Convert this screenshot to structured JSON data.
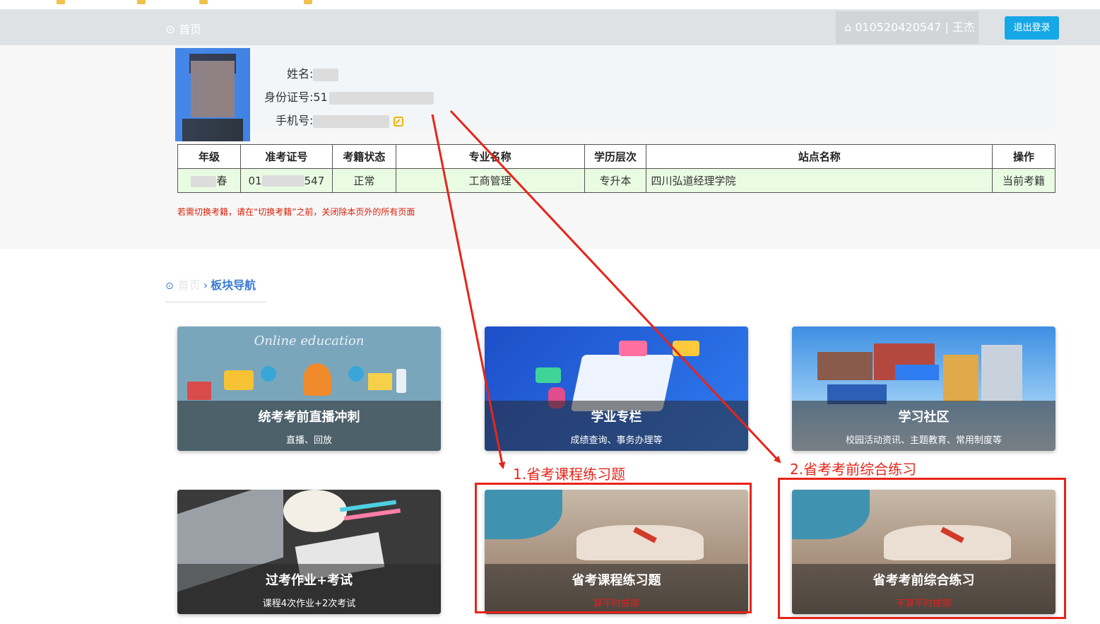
{
  "header": {
    "breadcrumb": "首页",
    "user_info": "010520420547 | 王杰",
    "logout_label": "退出登录"
  },
  "profile": {
    "name_label": "姓名:",
    "id_label": "身份证号:",
    "id_prefix": "51",
    "phone_label": "手机号:"
  },
  "table": {
    "headers": [
      "年级",
      "准考证号",
      "考籍状态",
      "专业名称",
      "学历层次",
      "站点名称",
      "操作"
    ],
    "row": {
      "grade_suffix": "春",
      "exam_no_prefix": "01",
      "exam_no_suffix": "547",
      "status": "正常",
      "major": "工商管理",
      "level": "专升本",
      "site": "四川弘道经理学院",
      "action": "当前考籍"
    }
  },
  "notice": "若需切换考籍，请在“切换考籍”之前，关闭除本页外的所有页面",
  "section": {
    "home": "首页",
    "sep": "›",
    "current": "板块导航"
  },
  "cards": [
    {
      "title": "统考考前直播冲刺",
      "subtitle": "直播、回放",
      "banner_text": "Online education"
    },
    {
      "title": "学业专栏",
      "subtitle": "成绩查询、事务办理等"
    },
    {
      "title": "学习社区",
      "subtitle": "校园活动资讯、主题教育、常用制度等"
    },
    {
      "title": "过考作业+考试",
      "subtitle": "课程4次作业+2次考试"
    },
    {
      "title": "省考课程练习题",
      "subtitle": "算平时成绩"
    },
    {
      "title": "省考考前综合练习",
      "subtitle": "不算平时成绩"
    }
  ],
  "annotations": {
    "label1": "1.省考课程练习题",
    "label2": "2.省考考前综合练习",
    "color": "#e8241a"
  }
}
